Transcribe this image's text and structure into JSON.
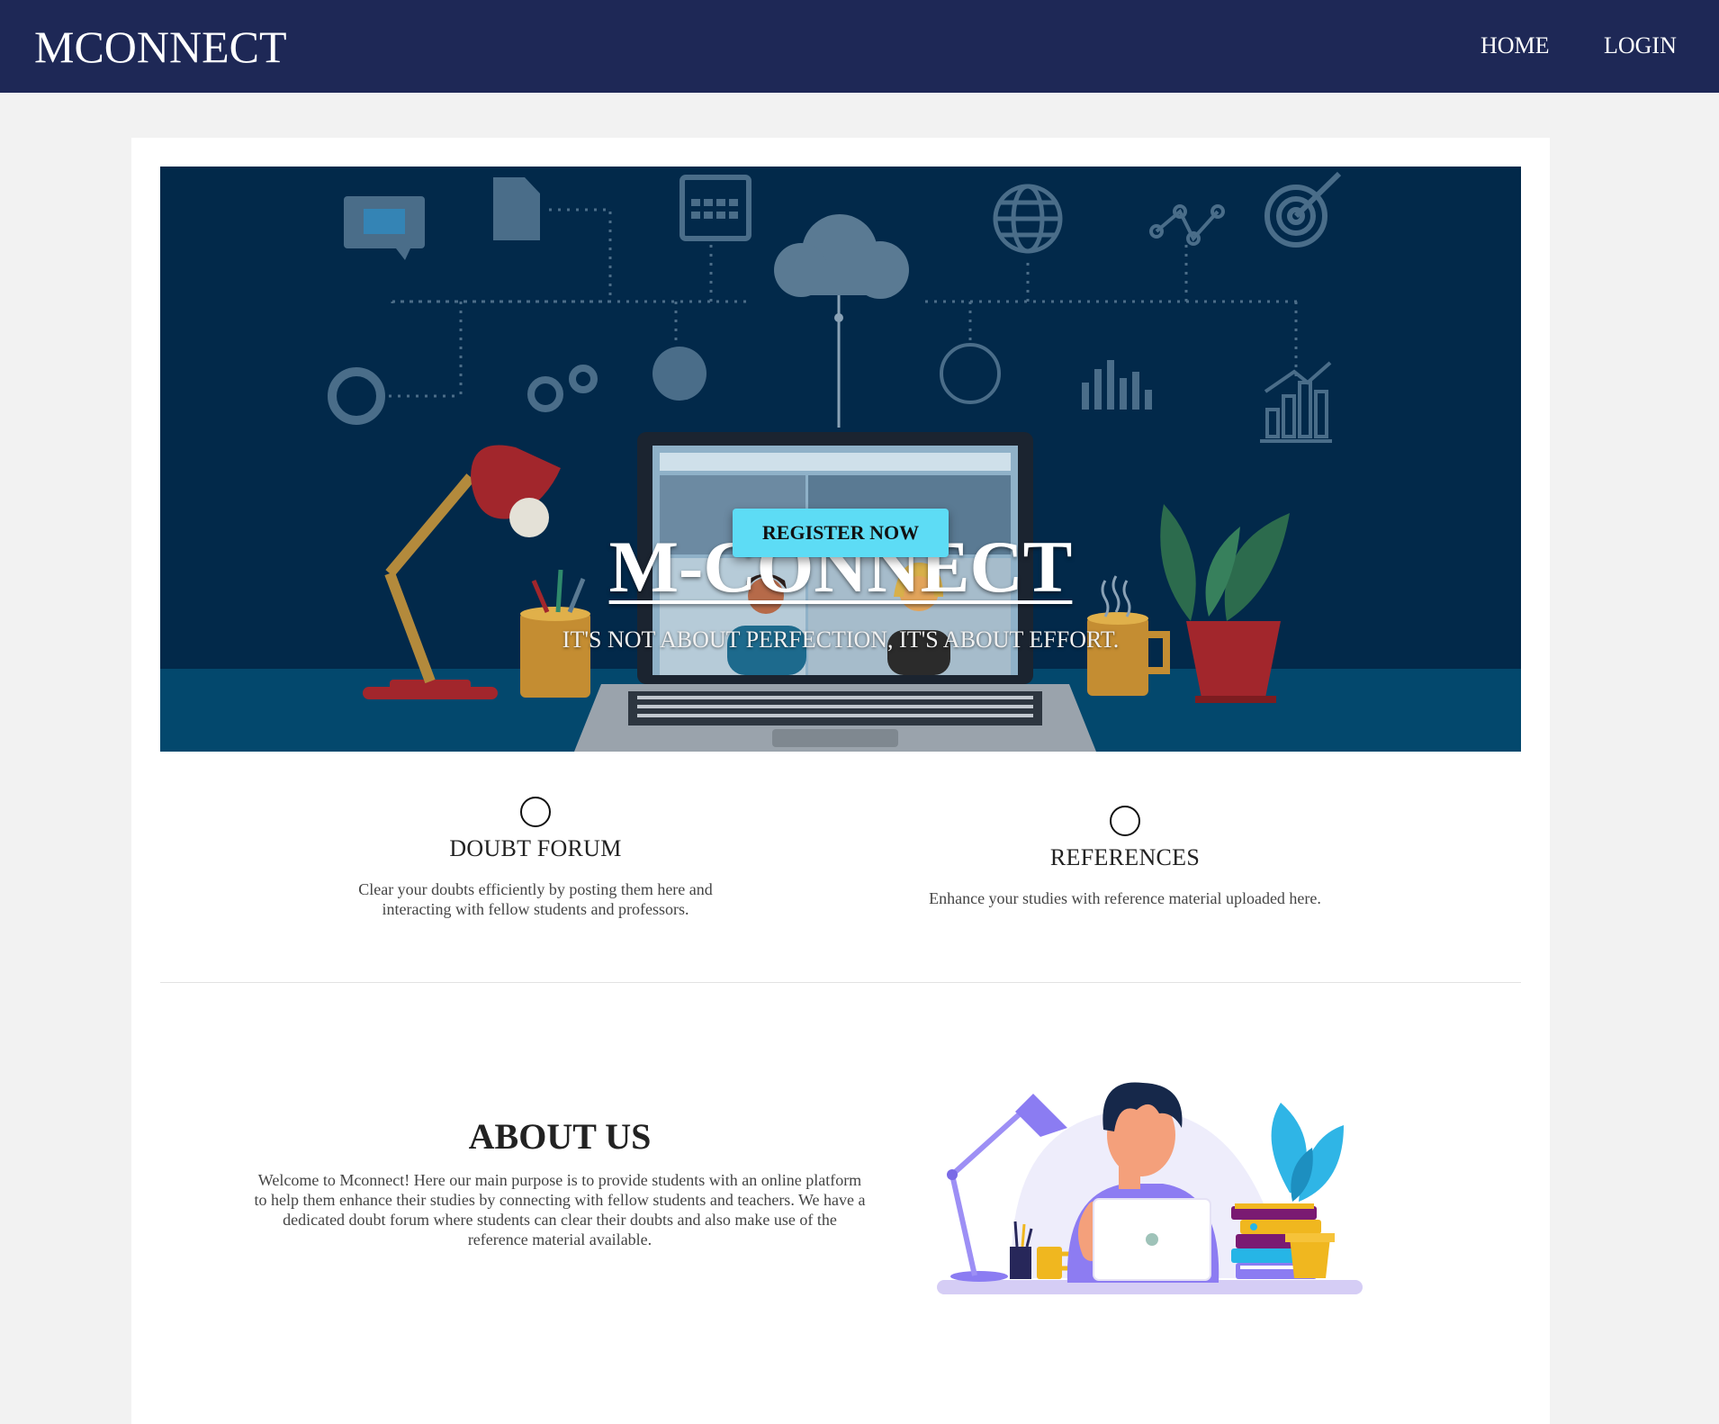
{
  "nav": {
    "brand": "MCONNECT",
    "links": [
      "HOME",
      "LOGIN"
    ]
  },
  "hero": {
    "title": "M-CONNECT",
    "tagline": "IT'S NOT ABOUT PERFECTION, IT'S ABOUT EFFORT.",
    "cta_label": "REGISTER NOW"
  },
  "features": [
    {
      "icon": "circle-icon",
      "title": "DOUBT FORUM",
      "description": "Clear your doubts efficiently by posting them here and interacting with fellow students and professors."
    },
    {
      "icon": "circle-icon",
      "title": "REFERENCES",
      "description": "Enhance your studies with reference material uploaded here."
    }
  ],
  "about": {
    "heading": "ABOUT US",
    "body": "Welcome to Mconnect! Here our main purpose is to provide students with an online platform to help them enhance their studies by connecting with fellow students and teachers. We have a dedicated doubt forum where students can clear their doubts and also make use of the reference material available."
  },
  "colors": {
    "navbar_bg": "#1e2856",
    "hero_bg": "#02294a",
    "cta_bg": "#5ddcf5",
    "page_bg": "#f2f2f2",
    "card_bg": "#ffffff"
  }
}
